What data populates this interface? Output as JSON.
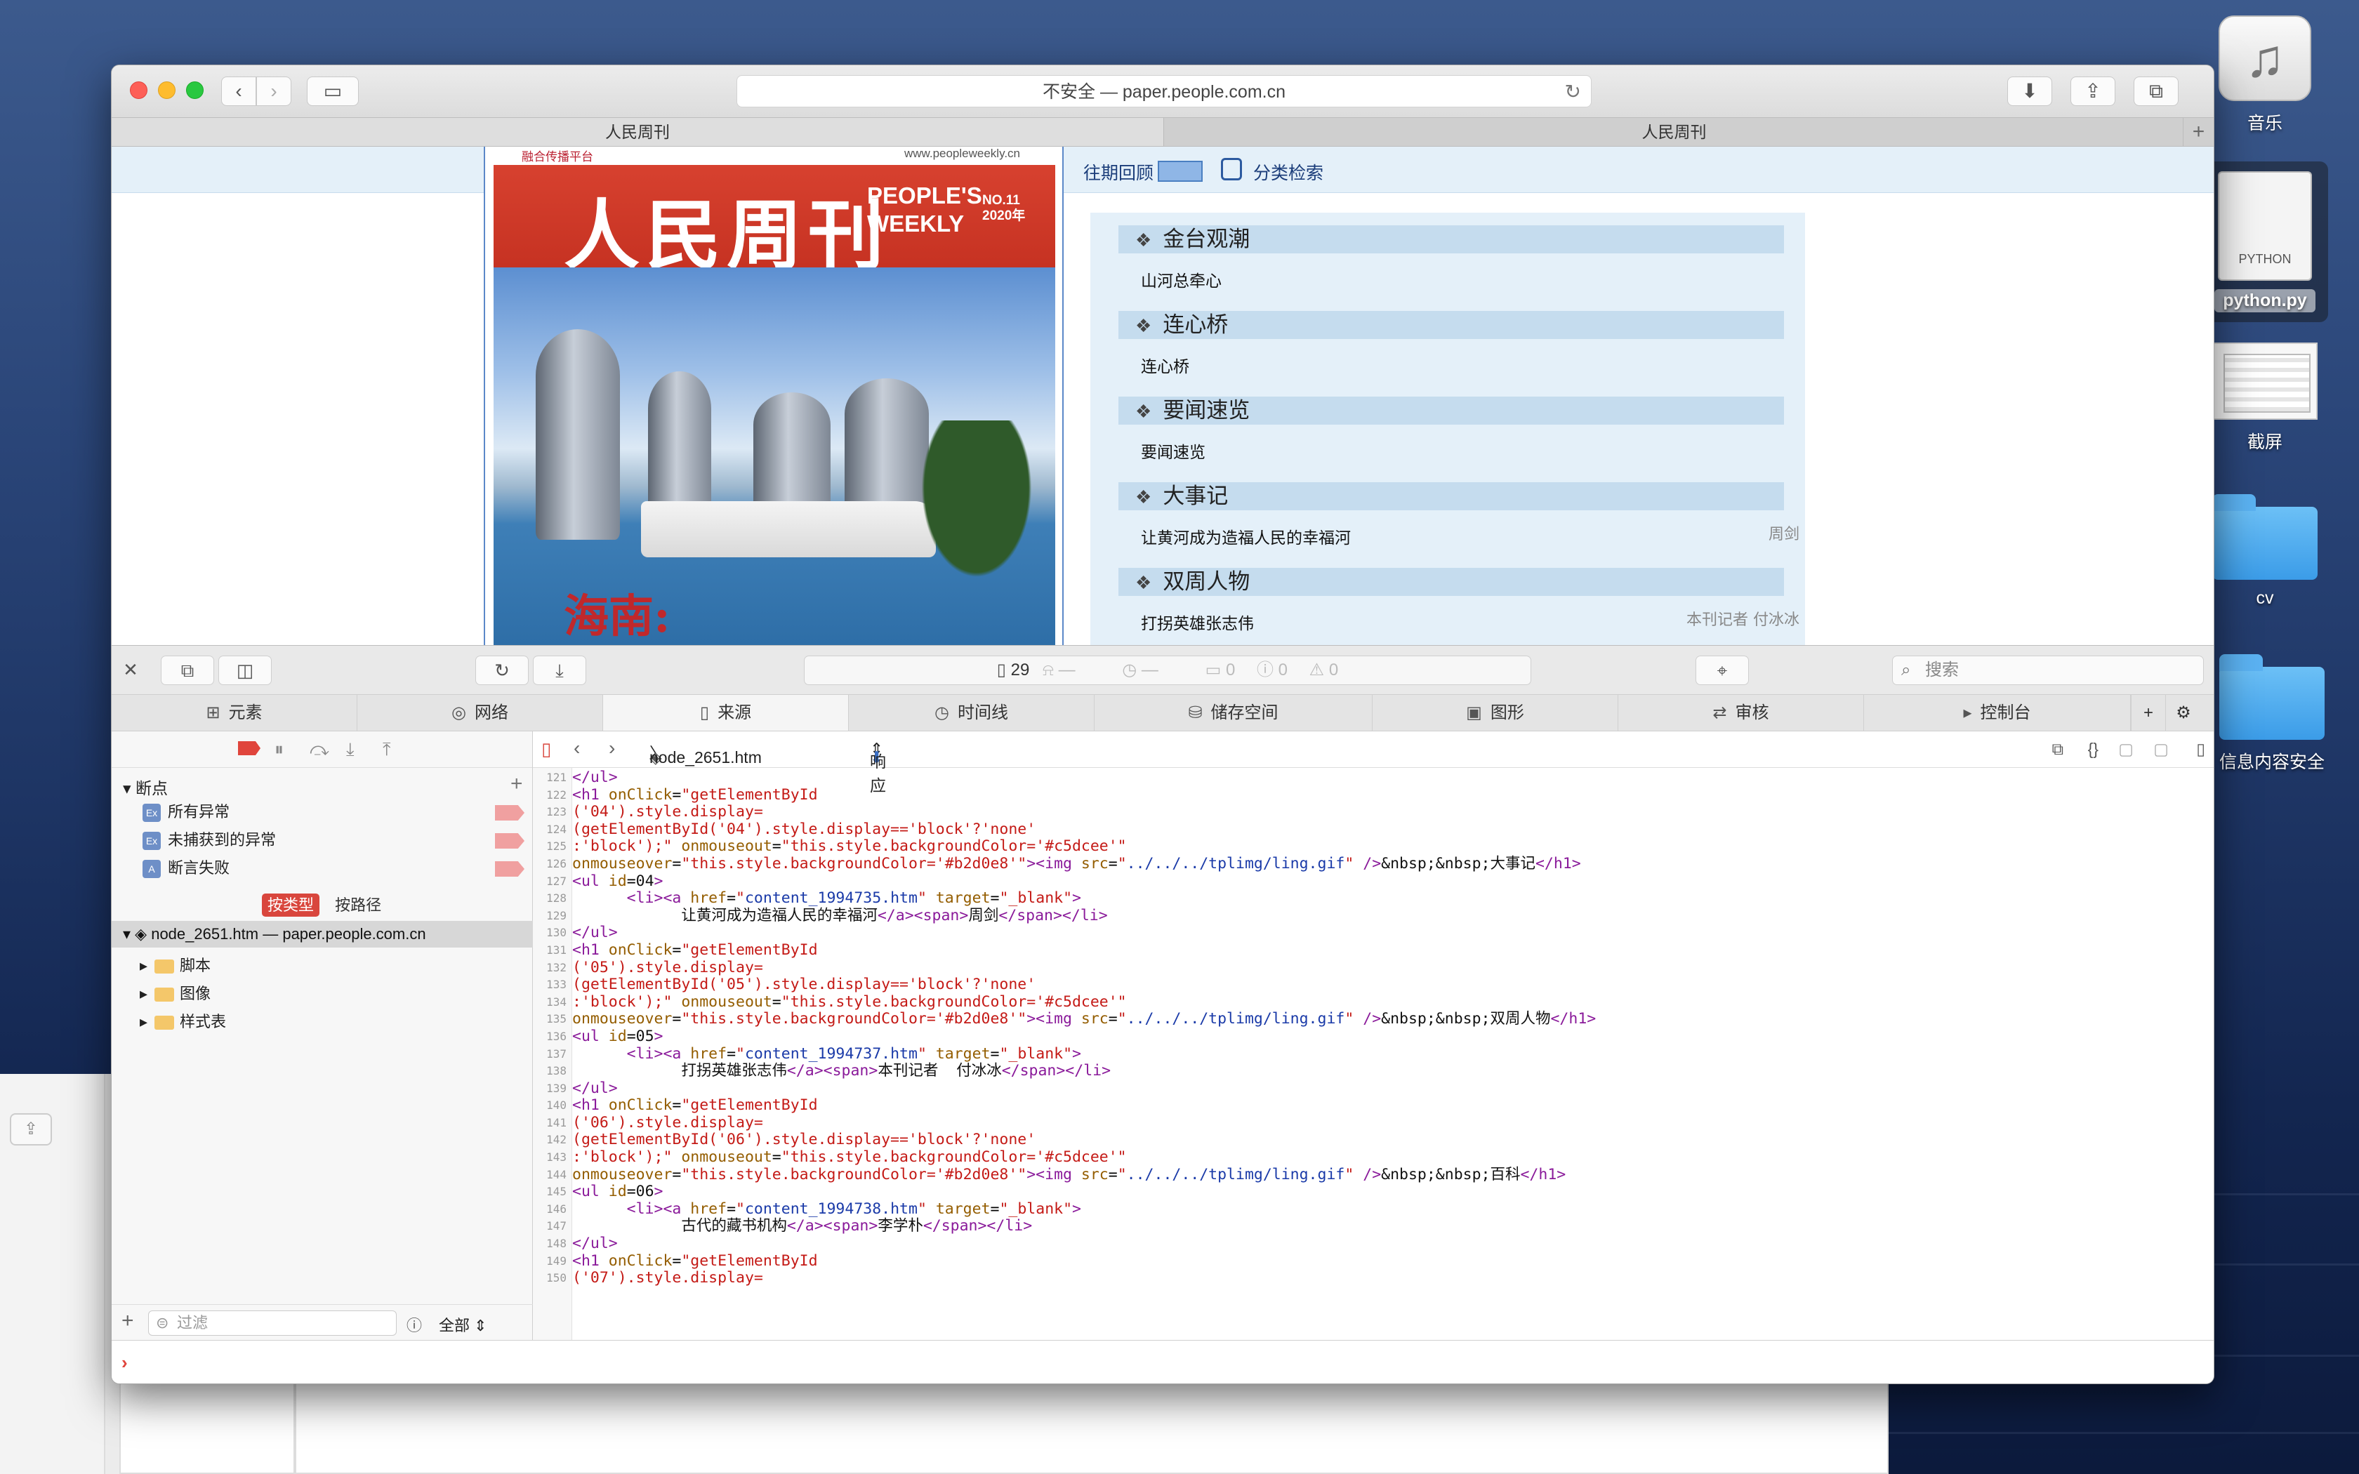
{
  "desktop": {
    "icons": [
      {
        "label": "音乐"
      },
      {
        "label": "python.py",
        "badge": "PYTHON"
      },
      {
        "label": "截屏"
      },
      {
        "label": "cv"
      },
      {
        "label": "信息内容安全"
      }
    ]
  },
  "browser": {
    "address": "不安全 — paper.people.com.cn",
    "tabs": [
      {
        "label": "人民周刊"
      },
      {
        "label": "人民周刊"
      }
    ]
  },
  "page": {
    "cover": {
      "brand_line": "融合传播平台",
      "website": "www.peopleweekly.cn",
      "title": "人民周刊",
      "title_en_line1": "PEOPLE'S",
      "title_en_line2": "WEEKLY",
      "issue_no": "NO.11",
      "issue_year": "2020年",
      "handwriting": "海南:"
    },
    "nav": {
      "past_issues": "往期回顾",
      "category_search": "分类检索"
    },
    "toc": [
      {
        "section": "金台观潮",
        "article": "山河总牵心",
        "author": ""
      },
      {
        "section": "连心桥",
        "article": "连心桥",
        "author": ""
      },
      {
        "section": "要闻速览",
        "article": "要闻速览",
        "author": ""
      },
      {
        "section": "大事记",
        "article": "让黄河成为造福人民的幸福河",
        "author": "周剑"
      },
      {
        "section": "双周人物",
        "article": "打拐英雄张志伟",
        "author": "本刊记者  付冰冰"
      }
    ]
  },
  "devtools": {
    "status": {
      "resources": "29",
      "a": "—",
      "b": "—",
      "logs": "0",
      "errors": "0",
      "warnings": "0"
    },
    "search_placeholder": "搜索",
    "tabs": [
      "元素",
      "网络",
      "来源",
      "时间线",
      "储存空间",
      "图形",
      "审核",
      "控制台"
    ],
    "sidebar": {
      "breakpoints_header": "断点",
      "breakpoints": [
        "所有异常",
        "未捕获到的异常",
        "断言失败"
      ],
      "group_by_type": "按类型",
      "group_by_path": "按路径",
      "resource_root": "node_2651.htm — paper.people.com.cn",
      "folders": [
        "脚本",
        "图像",
        "样式表"
      ],
      "filter_placeholder": "过滤",
      "filter_scope": "全部"
    },
    "editor": {
      "file": "node_2651.htm",
      "mode": "响应"
    },
    "code_lines": [
      {
        "n": "121",
        "html": "<span class='tg'>&lt;/ul&gt;</span>"
      },
      {
        "n": "122",
        "html": "<span class='tg'>&lt;h1</span> <span class='at'>onClick</span>=<span class='st'>\"getElementById</span>"
      },
      {
        "n": "123",
        "html": "<span class='st'>('04').style.display=</span>"
      },
      {
        "n": "124",
        "html": "<span class='st'>(getElementById('04').style.display=='block'?'none'</span>"
      },
      {
        "n": "125",
        "html": "<span class='st'>:'block');\"</span> <span class='at'>onmouseout</span>=<span class='st'>\"this.style.backgroundColor='#c5dcee'\"</span>"
      },
      {
        "n": "126",
        "html": "<span class='at'>onmouseover</span>=<span class='st'>\"this.style.backgroundColor='#b2d0e8'\"</span><span class='tg'>&gt;&lt;img</span> <span class='at'>src</span>=<span class='st'>\"</span><span class='lk'>../../../tplimg/ling.gif</span><span class='st'>\"</span> <span class='tg'>/&gt;</span><span class='tx'>&amp;nbsp;&amp;nbsp;大事记</span><span class='tg'>&lt;/h1&gt;</span>"
      },
      {
        "n": "127",
        "html": "<span class='tg'>&lt;ul</span> <span class='at'>id</span>=<span class='tx'>04</span><span class='tg'>&gt;</span>"
      },
      {
        "n": "128",
        "html": "      <span class='tg'>&lt;li&gt;&lt;a</span> <span class='at'>href</span>=<span class='st'>\"</span><span class='lk'>content_1994735.htm</span><span class='st'>\"</span> <span class='at'>target</span>=<span class='st'>\"_blank\"</span><span class='tg'>&gt;</span>"
      },
      {
        "n": "129",
        "html": "            <span class='tx'>让黄河成为造福人民的幸福河</span><span class='tg'>&lt;/a&gt;&lt;span&gt;</span><span class='tx'>周剑</span><span class='tg'>&lt;/span&gt;&lt;/li&gt;</span>"
      },
      {
        "n": "130",
        "html": "<span class='tg'>&lt;/ul&gt;</span>"
      },
      {
        "n": "131",
        "html": "<span class='tg'>&lt;h1</span> <span class='at'>onClick</span>=<span class='st'>\"getElementById</span>"
      },
      {
        "n": "132",
        "html": "<span class='st'>('05').style.display=</span>"
      },
      {
        "n": "133",
        "html": "<span class='st'>(getElementById('05').style.display=='block'?'none'</span>"
      },
      {
        "n": "134",
        "html": "<span class='st'>:'block');\"</span> <span class='at'>onmouseout</span>=<span class='st'>\"this.style.backgroundColor='#c5dcee'\"</span>"
      },
      {
        "n": "135",
        "html": "<span class='at'>onmouseover</span>=<span class='st'>\"this.style.backgroundColor='#b2d0e8'\"</span><span class='tg'>&gt;&lt;img</span> <span class='at'>src</span>=<span class='st'>\"</span><span class='lk'>../../../tplimg/ling.gif</span><span class='st'>\"</span> <span class='tg'>/&gt;</span><span class='tx'>&amp;nbsp;&amp;nbsp;双周人物</span><span class='tg'>&lt;/h1&gt;</span>"
      },
      {
        "n": "136",
        "html": "<span class='tg'>&lt;ul</span> <span class='at'>id</span>=<span class='tx'>05</span><span class='tg'>&gt;</span>"
      },
      {
        "n": "137",
        "html": "      <span class='tg'>&lt;li&gt;&lt;a</span> <span class='at'>href</span>=<span class='st'>\"</span><span class='lk'>content_1994737.htm</span><span class='st'>\"</span> <span class='at'>target</span>=<span class='st'>\"_blank\"</span><span class='tg'>&gt;</span>"
      },
      {
        "n": "138",
        "html": "            <span class='tx'>打拐英雄张志伟</span><span class='tg'>&lt;/a&gt;&lt;span&gt;</span><span class='tx'>本刊记者  付冰冰</span><span class='tg'>&lt;/span&gt;&lt;/li&gt;</span>"
      },
      {
        "n": "139",
        "html": "<span class='tg'>&lt;/ul&gt;</span>"
      },
      {
        "n": "140",
        "html": "<span class='tg'>&lt;h1</span> <span class='at'>onClick</span>=<span class='st'>\"getElementById</span>"
      },
      {
        "n": "141",
        "html": "<span class='st'>('06').style.display=</span>"
      },
      {
        "n": "142",
        "html": "<span class='st'>(getElementById('06').style.display=='block'?'none'</span>"
      },
      {
        "n": "143",
        "html": "<span class='st'>:'block');\"</span> <span class='at'>onmouseout</span>=<span class='st'>\"this.style.backgroundColor='#c5dcee'\"</span>"
      },
      {
        "n": "144",
        "html": "<span class='at'>onmouseover</span>=<span class='st'>\"this.style.backgroundColor='#b2d0e8'\"</span><span class='tg'>&gt;&lt;img</span> <span class='at'>src</span>=<span class='st'>\"</span><span class='lk'>../../../tplimg/ling.gif</span><span class='st'>\"</span> <span class='tg'>/&gt;</span><span class='tx'>&amp;nbsp;&amp;nbsp;百科</span><span class='tg'>&lt;/h1&gt;</span>"
      },
      {
        "n": "145",
        "html": "<span class='tg'>&lt;ul</span> <span class='at'>id</span>=<span class='tx'>06</span><span class='tg'>&gt;</span>"
      },
      {
        "n": "146",
        "html": "      <span class='tg'>&lt;li&gt;&lt;a</span> <span class='at'>href</span>=<span class='st'>\"</span><span class='lk'>content_1994738.htm</span><span class='st'>\"</span> <span class='at'>target</span>=<span class='st'>\"_blank\"</span><span class='tg'>&gt;</span>"
      },
      {
        "n": "147",
        "html": "            <span class='tx'>古代的藏书机构</span><span class='tg'>&lt;/a&gt;&lt;span&gt;</span><span class='tx'>李学朴</span><span class='tg'>&lt;/span&gt;&lt;/li&gt;</span>"
      },
      {
        "n": "148",
        "html": "<span class='tg'>&lt;/ul&gt;</span>"
      },
      {
        "n": "149",
        "html": "<span class='tg'>&lt;h1</span> <span class='at'>onClick</span>=<span class='st'>\"getElementById</span>"
      },
      {
        "n": "150",
        "html": "<span class='st'>('07').style.display=</span>"
      }
    ]
  },
  "colors": {
    "toc_head": "#c5dcee",
    "toc_bg": "#e4f0f9",
    "masthead": "#d7412f",
    "accent_red": "#e0453c"
  }
}
